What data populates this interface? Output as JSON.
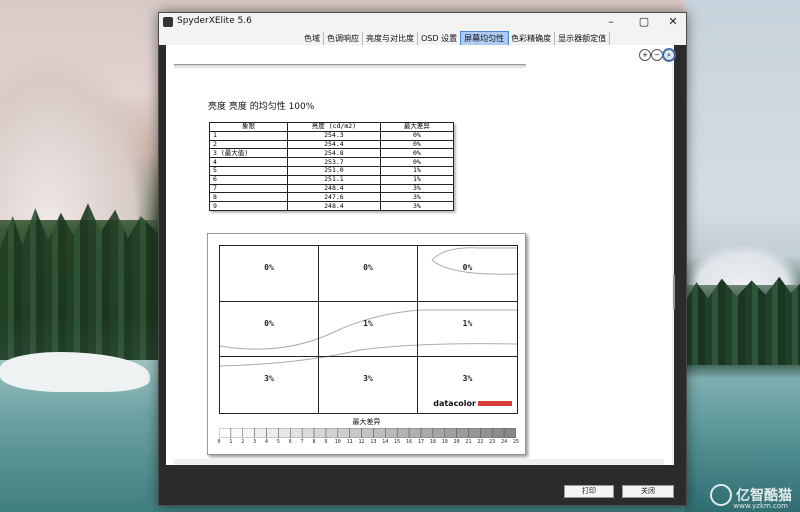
{
  "window": {
    "title": "SpyderXElite 5.6"
  },
  "tabs": [
    {
      "label": "色域",
      "active": false
    },
    {
      "label": "色调响应",
      "active": false
    },
    {
      "label": "亮度与对比度",
      "active": false
    },
    {
      "label": "OSD 设置",
      "active": false
    },
    {
      "label": "屏幕均匀性",
      "active": true
    },
    {
      "label": "色彩精确度",
      "active": false
    },
    {
      "label": "显示器额定值",
      "active": false
    }
  ],
  "zoom": {
    "zoom_in": "+",
    "zoom_out": "−",
    "zoom_fit": "⌕"
  },
  "report": {
    "heading": "亮度 亮度 的均匀性 100%",
    "table": {
      "headers": [
        "象限",
        "亮度 (cd/m2)",
        "最大差异"
      ],
      "rows": [
        [
          "1",
          "254.3",
          "0%"
        ],
        [
          "2",
          "254.4",
          "0%"
        ],
        [
          "3 (最大值)",
          "254.8",
          "0%"
        ],
        [
          "4",
          "253.7",
          "0%"
        ],
        [
          "5",
          "251.0",
          "1%"
        ],
        [
          "6",
          "251.1",
          "1%"
        ],
        [
          "7",
          "248.4",
          "3%"
        ],
        [
          "8",
          "247.6",
          "3%"
        ],
        [
          "9",
          "248.4",
          "3%"
        ]
      ]
    },
    "map": {
      "cells": [
        "0%",
        "0%",
        "0%",
        "0%",
        "1%",
        "1%",
        "3%",
        "3%",
        "3%"
      ],
      "brand": "datacolor",
      "brand_color": "#d93b3b"
    },
    "legend": {
      "title": "最大差异",
      "labels": [
        "0",
        "1",
        "2",
        "3",
        "4",
        "5",
        "6",
        "7",
        "8",
        "9",
        "10",
        "11",
        "12",
        "13",
        "14",
        "15",
        "16",
        "17",
        "18",
        "19",
        "20",
        "21",
        "22",
        "23",
        "24",
        "25"
      ]
    }
  },
  "buttons": {
    "print": "打印",
    "close": "关闭"
  },
  "watermark": {
    "text": "亿智酷猫",
    "sub": "www.yzkm.com"
  }
}
